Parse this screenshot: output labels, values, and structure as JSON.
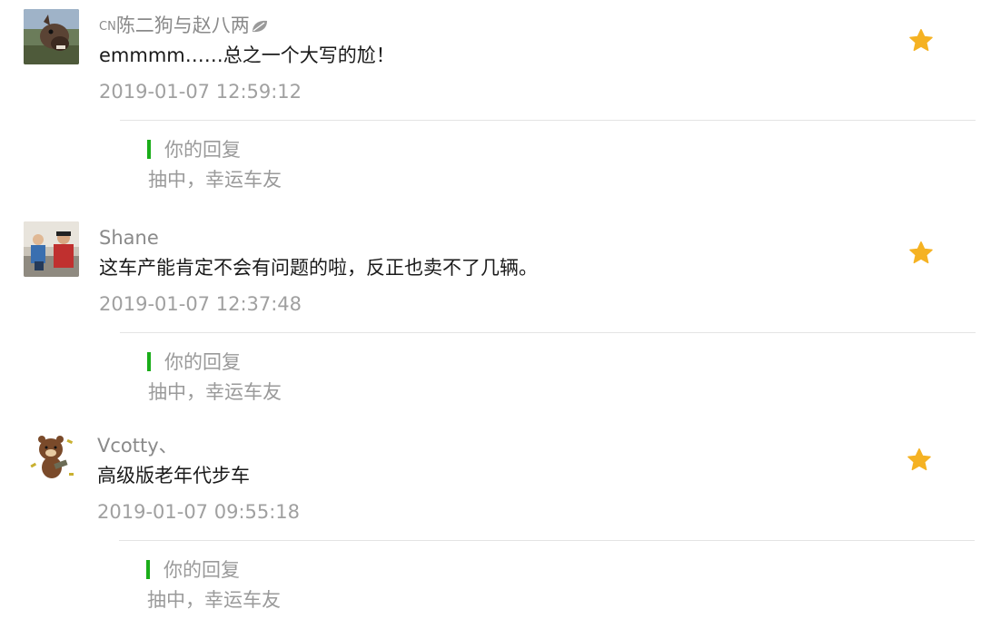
{
  "accent_color": "#1aad19",
  "star_color": "#f5b223",
  "comments": [
    {
      "username_prefix": "CN",
      "username": "陈二狗与赵八两",
      "username_icon": "leaf-icon",
      "content": "emmmm……总之一个大写的尬！",
      "timestamp": "2019-01-07 12:59:12",
      "star_icon": "star-icon",
      "reply": {
        "title": "你的回复",
        "body": "抽中，幸运车友"
      }
    },
    {
      "username": "Shane",
      "content": "这车产能肯定不会有问题的啦，反正也卖不了几辆。",
      "timestamp": "2019-01-07 12:37:48",
      "star_icon": "star-icon",
      "reply": {
        "title": "你的回复",
        "body": "抽中，幸运车友"
      }
    },
    {
      "username": "Vcotty、",
      "content": "高级版老年代步车",
      "timestamp": "2019-01-07 09:55:18",
      "star_icon": "star-icon",
      "reply": {
        "title": "你的回复",
        "body": "抽中，幸运车友"
      }
    }
  ]
}
